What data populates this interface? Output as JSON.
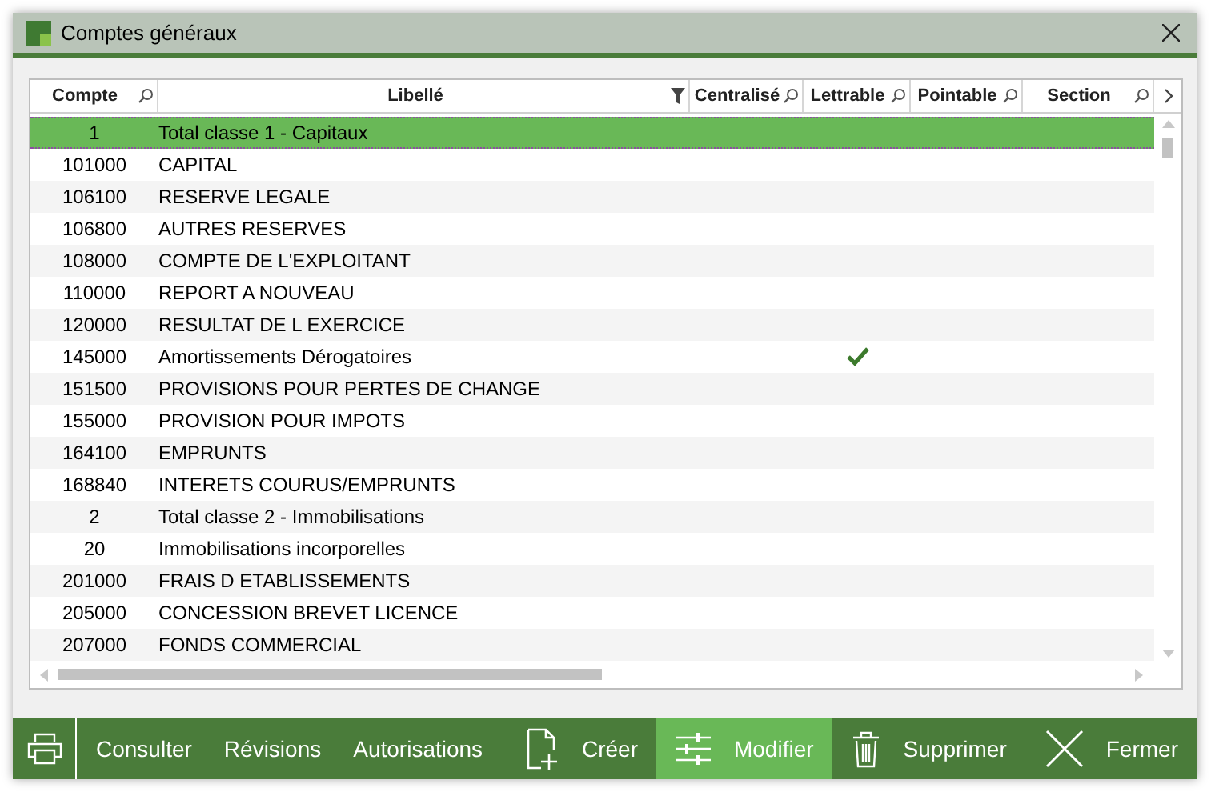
{
  "window": {
    "title": "Comptes généraux"
  },
  "table": {
    "columns": [
      {
        "label": "Compte",
        "search": true,
        "filter": false
      },
      {
        "label": "Libellé",
        "search": false,
        "filter": true
      },
      {
        "label": "Centralisé",
        "search": true,
        "filter": false
      },
      {
        "label": "Lettrable",
        "search": true,
        "filter": false
      },
      {
        "label": "Pointable",
        "search": true,
        "filter": false
      },
      {
        "label": "Section",
        "search": true,
        "filter": false
      }
    ],
    "rows": [
      {
        "compte": "1",
        "libelle": "Total classe 1 - Capitaux",
        "lettrable": false,
        "selected": true
      },
      {
        "compte": "101000",
        "libelle": "CAPITAL",
        "lettrable": false,
        "selected": false
      },
      {
        "compte": "106100",
        "libelle": "RESERVE LEGALE",
        "lettrable": false,
        "selected": false
      },
      {
        "compte": "106800",
        "libelle": "AUTRES RESERVES",
        "lettrable": false,
        "selected": false
      },
      {
        "compte": "108000",
        "libelle": "COMPTE DE L'EXPLOITANT",
        "lettrable": false,
        "selected": false
      },
      {
        "compte": "110000",
        "libelle": "REPORT A NOUVEAU",
        "lettrable": false,
        "selected": false
      },
      {
        "compte": "120000",
        "libelle": "RESULTAT DE L EXERCICE",
        "lettrable": false,
        "selected": false
      },
      {
        "compte": "145000",
        "libelle": "Amortissements Dérogatoires",
        "lettrable": true,
        "selected": false
      },
      {
        "compte": "151500",
        "libelle": "PROVISIONS POUR PERTES DE CHANGE",
        "lettrable": false,
        "selected": false
      },
      {
        "compte": "155000",
        "libelle": "PROVISION POUR IMPOTS",
        "lettrable": false,
        "selected": false
      },
      {
        "compte": "164100",
        "libelle": "EMPRUNTS",
        "lettrable": false,
        "selected": false
      },
      {
        "compte": "168840",
        "libelle": "INTERETS COURUS/EMPRUNTS",
        "lettrable": false,
        "selected": false
      },
      {
        "compte": "2",
        "libelle": "Total classe 2 - Immobilisations",
        "lettrable": false,
        "selected": false
      },
      {
        "compte": "20",
        "libelle": "Immobilisations incorporelles",
        "lettrable": false,
        "selected": false
      },
      {
        "compte": "201000",
        "libelle": "FRAIS D ETABLISSEMENTS",
        "lettrable": false,
        "selected": false
      },
      {
        "compte": "205000",
        "libelle": "CONCESSION BREVET LICENCE",
        "lettrable": false,
        "selected": false
      },
      {
        "compte": "207000",
        "libelle": "FONDS COMMERCIAL",
        "lettrable": false,
        "selected": false
      }
    ]
  },
  "toolbar": {
    "left": [
      {
        "label": "Consulter"
      },
      {
        "label": "Révisions"
      },
      {
        "label": "Autorisations"
      }
    ],
    "right": [
      {
        "kind": "create",
        "label": "Créer",
        "selected": false
      },
      {
        "kind": "edit",
        "label": "Modifier",
        "selected": true
      },
      {
        "kind": "delete",
        "label": "Supprimer",
        "selected": false
      },
      {
        "kind": "close",
        "label": "Fermer",
        "selected": false
      }
    ]
  }
}
